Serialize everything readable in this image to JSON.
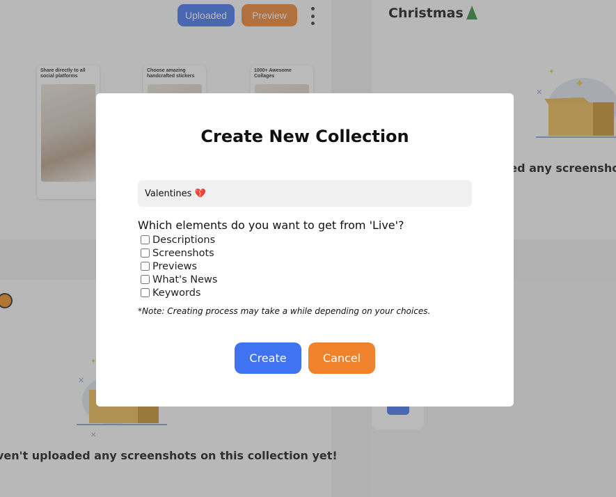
{
  "header": {
    "uploaded_label": "Uploaded",
    "preview_label": "Preview"
  },
  "cards": [
    {
      "caption": "Share directly to all social platforms"
    },
    {
      "caption": "Choose amazing handcrafted stickers"
    },
    {
      "caption": "1000+ Awesome Collages"
    }
  ],
  "collections": {
    "christmas_title": "Christmas",
    "empty_msg_partial_right": "aded any screenshots",
    "empty_msg_partial_left": "ven't uploaded any screenshots on this collection yet!"
  },
  "modal": {
    "title": "Create New Collection",
    "name_value": "Valentines 💔",
    "question": "Which elements do you want to get from 'Live'?",
    "options": [
      {
        "label": "Descriptions",
        "checked": false
      },
      {
        "label": "Screenshots",
        "checked": false
      },
      {
        "label": "Previews",
        "checked": false
      },
      {
        "label": "What's News",
        "checked": false
      },
      {
        "label": "Keywords",
        "checked": false
      }
    ],
    "note": "*Note: Creating process may take a while depending on your choices.",
    "create_label": "Create",
    "cancel_label": "Cancel"
  },
  "colors": {
    "primary": "#3f73f2",
    "accent": "#f0822b"
  }
}
